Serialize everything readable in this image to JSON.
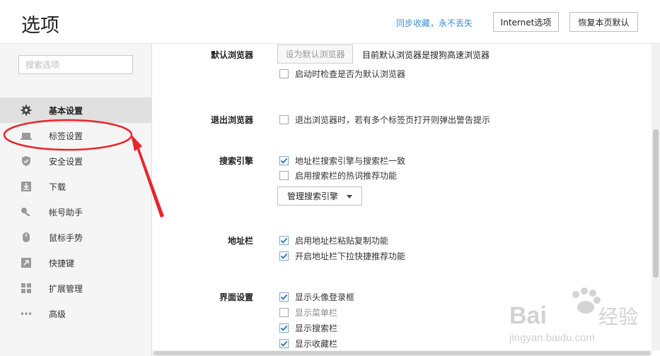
{
  "header": {
    "title": "选项",
    "sync_link": "同步收藏，永不丢失",
    "internet_options_button": "Internet选项",
    "restore_defaults_button": "恢复本页默认"
  },
  "sidebar": {
    "search_placeholder": "搜索选项",
    "items": [
      {
        "label": "基本设置",
        "icon": "gear-icon",
        "active": true
      },
      {
        "label": "标签设置",
        "icon": "tab-icon",
        "active": false
      },
      {
        "label": "安全设置",
        "icon": "shield-icon",
        "active": false
      },
      {
        "label": "下载",
        "icon": "download-icon",
        "active": false
      },
      {
        "label": "帐号助手",
        "icon": "key-icon",
        "active": false
      },
      {
        "label": "鼠标手势",
        "icon": "mouse-icon",
        "active": false
      },
      {
        "label": "快捷键",
        "icon": "shortcut-arrow-icon",
        "active": false
      },
      {
        "label": "扩展管理",
        "icon": "grid-icon",
        "active": false
      },
      {
        "label": "高级",
        "icon": "more-dots-icon",
        "active": false
      }
    ]
  },
  "content": {
    "default_browser": {
      "label": "默认浏览器",
      "set_default_button": "设为默认浏览器",
      "note": "目前默认浏览器是搜狗高速浏览器",
      "check_on_start": {
        "label": "启动时检查是否为默认浏览器",
        "checked": false
      }
    },
    "exit_browser": {
      "label": "退出浏览器",
      "warn_multi_tabs": {
        "label": "退出浏览器时，若有多个标签页打开则弹出警告提示",
        "checked": false
      }
    },
    "search_engine": {
      "label": "搜索引擎",
      "address_bar_consistent": {
        "label": "地址栏搜索引擎与搜索栏一致",
        "checked": true
      },
      "hot_words": {
        "label": "启用搜索栏的热词推荐功能",
        "checked": false
      },
      "manage_button": "管理搜索引擎"
    },
    "address_bar": {
      "label": "地址栏",
      "paste_copy": {
        "label": "启用地址栏粘贴复制功能",
        "checked": true
      },
      "dropdown_suggest": {
        "label": "开启地址栏下拉快捷推荐功能",
        "checked": true
      }
    },
    "interface": {
      "label": "界面设置",
      "show_avatar": {
        "label": "显示头像登录框",
        "checked": true
      },
      "show_menubar": {
        "label": "显示菜单栏",
        "checked": false
      },
      "show_searchbar": {
        "label": "显示搜索栏",
        "checked": true
      },
      "show_favorites": {
        "label": "显示收藏栏",
        "checked": true
      }
    }
  },
  "watermark": {
    "brand": "Bai",
    "brand_suffix": "经验",
    "url": "jingyan.baidu.com"
  },
  "colors": {
    "accent": "#3c8fd6",
    "annotation": "#e8262b",
    "active_bg": "#e0e0e0",
    "sidebar_bg": "#f5f5f5"
  }
}
